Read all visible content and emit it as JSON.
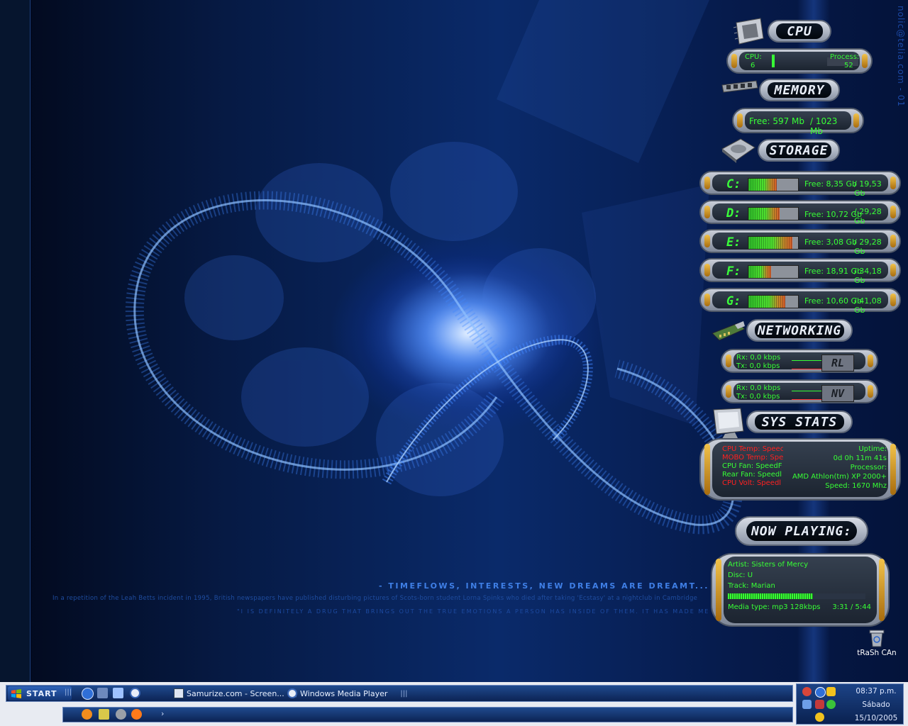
{
  "wallpaper": {
    "vertical_email": "nolic@telia.com - 01",
    "tagline": "- TIMEFLOWS, INTERESTS, NEW DREAMS ARE DREAMT... SUCH IS THE NATURE IN LIFE",
    "story": "In a repetition of the Leah Betts incident in 1995, British newspapers have published disturbing pictures of Scots-born student Lorna Spinks who died after taking 'Ecstasy' at a nightclub in Cambridge",
    "quote": "\"I IS DEFINITELY A DRUG THAT BRINGS OUT THE TRUE EMOTIONS A PERSON HAS INSIDE OF THEM. IT HAS MADE ME REALIZE"
  },
  "cpu": {
    "header": "CPU",
    "cpu_label": "CPU:",
    "cpu_value": "6",
    "cpu_fraction": 0.06,
    "process_label": "Process:",
    "process_value": "52"
  },
  "memory": {
    "header": "MEMORY",
    "free_text": "Free: 597 Mb",
    "total_text": "/ 1023 Mb"
  },
  "storage": {
    "header": "STORAGE",
    "drives": [
      {
        "letter": "C:",
        "free": "Free: 8,35 Gb",
        "total": "/ 19,53 Gb",
        "used_fraction": 0.57
      },
      {
        "letter": "D:",
        "free": "Free: 10,72 Gb",
        "total": "/ 29,28 Gb",
        "used_fraction": 0.63
      },
      {
        "letter": "E:",
        "free": "Free: 3,08 Gb",
        "total": "/ 29,28 Gb",
        "used_fraction": 0.89
      },
      {
        "letter": "F:",
        "free": "Free: 18,91 Gb",
        "total": "/ 34,18 Gb",
        "used_fraction": 0.45
      },
      {
        "letter": "G:",
        "free": "Free: 10,60 Gb",
        "total": "/ 41,08 Gb",
        "used_fraction": 0.74
      }
    ]
  },
  "networking": {
    "header": "NETWORKING",
    "adapters": [
      {
        "rx": "Rx: 0,0 kbps",
        "tx": "Tx: 0,0 kbps",
        "tag": "RL"
      },
      {
        "rx": "Rx: 0,0 kbps",
        "tx": "Tx: 0,0 kbps",
        "tag": "NV"
      }
    ]
  },
  "sys_stats": {
    "header": "SYS STATS",
    "left_lines": [
      {
        "text": "CPU Temp: Speec",
        "color": "#ff2020"
      },
      {
        "text": "MOBO Temp: Spe",
        "color": "#ff2020"
      },
      {
        "text": "CPU Fan: SpeedF",
        "color": "#37ff35"
      },
      {
        "text": "Rear Fan: Speedl",
        "color": "#37ff35"
      },
      {
        "text": "CPU Volt: Speedl",
        "color": "#ff2020"
      }
    ],
    "uptime_label": "Uptime:",
    "uptime_value": "0d 0h 11m 41s",
    "processor_label": "Processor:",
    "processor_value": "AMD Athlon(tm) XP 2000+",
    "speed_value": "Speed: 1670 Mhz"
  },
  "now_playing": {
    "header": "NOW PLAYING:",
    "artist": "Artist: Sisters of Mercy",
    "disc": "Disc: U",
    "track": "Track: Marian",
    "progress_fraction": 0.62,
    "media_type": "Media type: mp3 128kbps",
    "time": "3:31 / 5:44"
  },
  "desktop_icons": {
    "trash_label": "tRaSh CAn"
  },
  "taskbar": {
    "start_label": "START",
    "tasks": [
      {
        "label": "Samurize.com - Screen..."
      },
      {
        "label": "Windows Media Player"
      }
    ],
    "clock_time": "08:37 p.m.",
    "clock_day": "Sábado",
    "clock_date": "15/10/2005"
  },
  "colors": {
    "led_green": "#37ff35",
    "alert_red": "#ff2020",
    "wallpaper_blue": "#0a2a6a",
    "taskbar_blue": "#0c2354"
  }
}
